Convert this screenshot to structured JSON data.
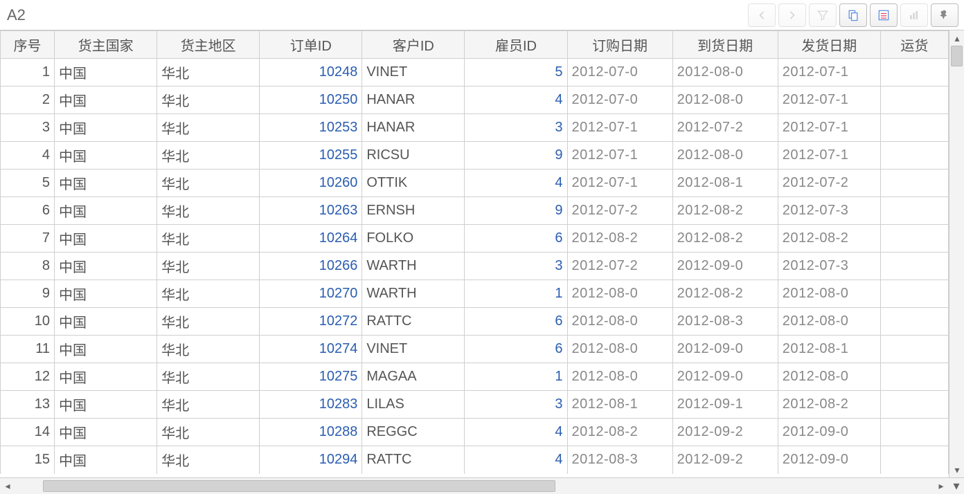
{
  "toolbar": {
    "cellRef": "A2"
  },
  "columns": [
    "序号",
    "货主国家",
    "货主地区",
    "订单ID",
    "客户ID",
    "雇员ID",
    "订购日期",
    "到货日期",
    "发货日期",
    "运货"
  ],
  "rows": [
    {
      "seq": "1",
      "country": "中国",
      "region": "华北",
      "order": "10248",
      "cust": "VINET",
      "emp": "5",
      "d1": "2012-07-0",
      "d2": "2012-08-0",
      "d3": "2012-07-1"
    },
    {
      "seq": "2",
      "country": "中国",
      "region": "华北",
      "order": "10250",
      "cust": "HANAR",
      "emp": "4",
      "d1": "2012-07-0",
      "d2": "2012-08-0",
      "d3": "2012-07-1"
    },
    {
      "seq": "3",
      "country": "中国",
      "region": "华北",
      "order": "10253",
      "cust": "HANAR",
      "emp": "3",
      "d1": "2012-07-1",
      "d2": "2012-07-2",
      "d3": "2012-07-1"
    },
    {
      "seq": "4",
      "country": "中国",
      "region": "华北",
      "order": "10255",
      "cust": "RICSU",
      "emp": "9",
      "d1": "2012-07-1",
      "d2": "2012-08-0",
      "d3": "2012-07-1"
    },
    {
      "seq": "5",
      "country": "中国",
      "region": "华北",
      "order": "10260",
      "cust": "OTTIK",
      "emp": "4",
      "d1": "2012-07-1",
      "d2": "2012-08-1",
      "d3": "2012-07-2"
    },
    {
      "seq": "6",
      "country": "中国",
      "region": "华北",
      "order": "10263",
      "cust": "ERNSH",
      "emp": "9",
      "d1": "2012-07-2",
      "d2": "2012-08-2",
      "d3": "2012-07-3"
    },
    {
      "seq": "7",
      "country": "中国",
      "region": "华北",
      "order": "10264",
      "cust": "FOLKO",
      "emp": "6",
      "d1": "2012-08-2",
      "d2": "2012-08-2",
      "d3": "2012-08-2"
    },
    {
      "seq": "8",
      "country": "中国",
      "region": "华北",
      "order": "10266",
      "cust": "WARTH",
      "emp": "3",
      "d1": "2012-07-2",
      "d2": "2012-09-0",
      "d3": "2012-07-3"
    },
    {
      "seq": "9",
      "country": "中国",
      "region": "华北",
      "order": "10270",
      "cust": "WARTH",
      "emp": "1",
      "d1": "2012-08-0",
      "d2": "2012-08-2",
      "d3": "2012-08-0"
    },
    {
      "seq": "10",
      "country": "中国",
      "region": "华北",
      "order": "10272",
      "cust": "RATTC",
      "emp": "6",
      "d1": "2012-08-0",
      "d2": "2012-08-3",
      "d3": "2012-08-0"
    },
    {
      "seq": "11",
      "country": "中国",
      "region": "华北",
      "order": "10274",
      "cust": "VINET",
      "emp": "6",
      "d1": "2012-08-0",
      "d2": "2012-09-0",
      "d3": "2012-08-1"
    },
    {
      "seq": "12",
      "country": "中国",
      "region": "华北",
      "order": "10275",
      "cust": "MAGAA",
      "emp": "1",
      "d1": "2012-08-0",
      "d2": "2012-09-0",
      "d3": "2012-08-0"
    },
    {
      "seq": "13",
      "country": "中国",
      "region": "华北",
      "order": "10283",
      "cust": "LILAS",
      "emp": "3",
      "d1": "2012-08-1",
      "d2": "2012-09-1",
      "d3": "2012-08-2"
    },
    {
      "seq": "14",
      "country": "中国",
      "region": "华北",
      "order": "10288",
      "cust": "REGGC",
      "emp": "4",
      "d1": "2012-08-2",
      "d2": "2012-09-2",
      "d3": "2012-09-0"
    },
    {
      "seq": "15",
      "country": "中国",
      "region": "华北",
      "order": "10294",
      "cust": "RATTC",
      "emp": "4",
      "d1": "2012-08-3",
      "d2": "2012-09-2",
      "d3": "2012-09-0"
    }
  ]
}
